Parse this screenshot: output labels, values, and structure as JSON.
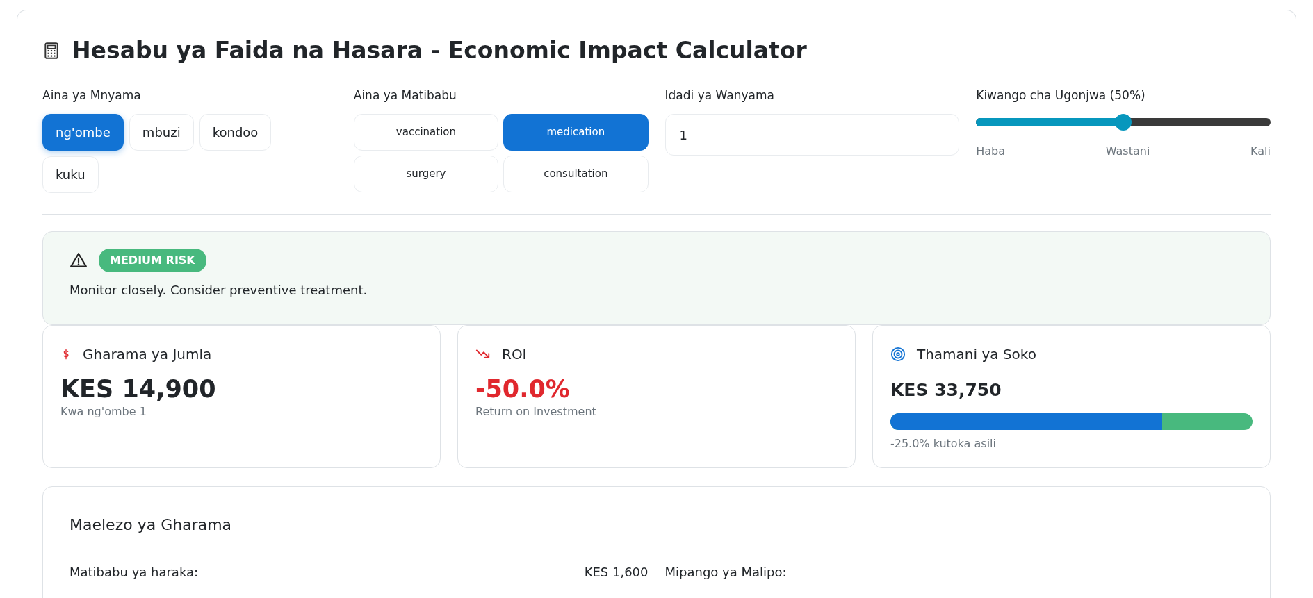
{
  "header": {
    "title": "Hesabu ya Faida na Hasara - Economic Impact Calculator"
  },
  "species": {
    "label": "Aina ya Mnyama",
    "options": [
      {
        "label": "ng'ombe",
        "selected": true
      },
      {
        "label": "mbuzi",
        "selected": false
      },
      {
        "label": "kondoo",
        "selected": false
      },
      {
        "label": "kuku",
        "selected": false
      }
    ]
  },
  "treatment": {
    "label": "Aina ya Matibabu",
    "options": [
      {
        "label": "vaccination",
        "selected": false
      },
      {
        "label": "medication",
        "selected": true
      },
      {
        "label": "surgery",
        "selected": false
      },
      {
        "label": "consultation",
        "selected": false
      }
    ]
  },
  "count": {
    "label": "Idadi ya Wanyama",
    "value": "1"
  },
  "severity": {
    "label": "Kiwango cha Ugonjwa (50%)",
    "level": 0.5,
    "scale": [
      "Haba",
      "Wastani",
      "Kali"
    ]
  },
  "risk": {
    "badge": "MEDIUM RISK",
    "message": "Monitor closely. Consider preventive treatment."
  },
  "cards": [
    {
      "kind": "cost",
      "title": "Gharama ya Jumla",
      "value": "KES 14,900",
      "note": "Kwa ng'ombe 1"
    },
    {
      "kind": "roi",
      "title": "ROI",
      "value": "-50.0%",
      "note": "Return on Investment"
    },
    {
      "kind": "market",
      "title": "Thamani ya Soko",
      "value": "KES 33,750",
      "level": 0.75,
      "note": "-25.0% kutoka asili"
    }
  ],
  "breakdown": {
    "title": "Maelezo ya Gharama",
    "rows": [
      {
        "label": "Matibabu ya haraka:",
        "value": "KES 1,600"
      }
    ],
    "side_title": "Mipango ya Malipo:"
  }
}
